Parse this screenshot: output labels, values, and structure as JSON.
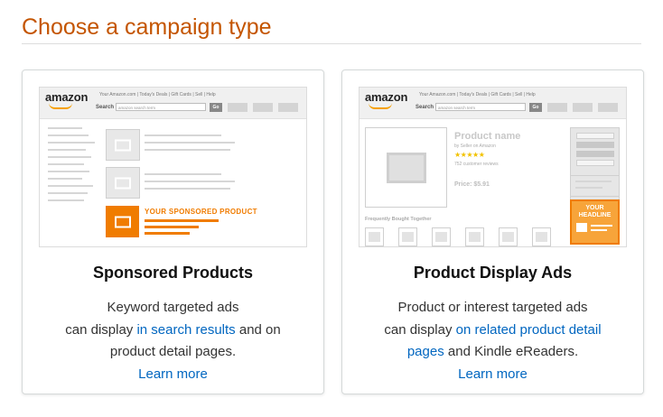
{
  "page": {
    "title": "Choose a campaign type"
  },
  "colors": {
    "title": "#c45500",
    "link": "#0066c0",
    "accent": "#f07c00"
  },
  "cards": [
    {
      "title": "Sponsored Products",
      "desc_line1": "Keyword targeted ads",
      "desc_line2_pre": "can display ",
      "desc_line2_link": "in search results",
      "desc_line2_post": " and on",
      "desc_line3": "product detail pages.",
      "learn_more": "Learn more",
      "preview": {
        "logo": "amazon",
        "header_links": "Your Amazon.com | Today's Deals | Gift Cards | Sell | Help",
        "search_label": "Search",
        "search_placeholder": "amazon search term",
        "go_label": "Go",
        "sponsored_text": "YOUR SPONSORED PRODUCT"
      }
    },
    {
      "title": "Product Display Ads",
      "desc_line1": "Product or interest targeted ads",
      "desc_line2_pre": "can display ",
      "desc_line2_link": "on related product detail",
      "desc_line3_link": "pages",
      "desc_line3_post": " and Kindle eReaders.",
      "learn_more": "Learn more",
      "preview": {
        "logo": "amazon",
        "header_links": "Your Amazon.com | Today's Deals | Gift Cards | Sell | Help",
        "search_label": "Search",
        "search_placeholder": "amazon search term",
        "go_label": "Go",
        "product_name": "Product name",
        "seller": "by Seller on Amazon",
        "stars": "★★★★★",
        "reviews": "752 customer reviews",
        "price": "Price: $5.91",
        "frequently_bought": "Frequently Bought Together",
        "headline": "YOUR HEADLINE"
      }
    }
  ]
}
